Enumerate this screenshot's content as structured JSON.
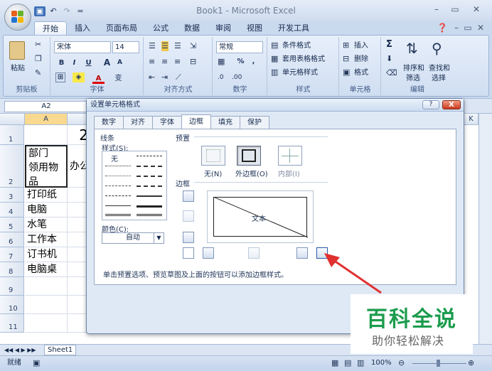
{
  "window": {
    "title": "Book1 - Microsoft Excel"
  },
  "qat": {
    "undo": "↶",
    "redo": "↷",
    "save": "▣",
    "sep": "="
  },
  "tabs": [
    "开始",
    "插入",
    "页面布局",
    "公式",
    "数据",
    "审阅",
    "视图",
    "开发工具"
  ],
  "ribbon": {
    "clipboard": {
      "paste": "粘贴",
      "label": "剪贴板"
    },
    "font": {
      "name": "宋体",
      "size": "14",
      "label": "字体",
      "bold": "B",
      "italic": "I",
      "underline": "U",
      "grow": "A",
      "shrink": "A",
      "color": "A",
      "wen": "变"
    },
    "alignment": {
      "label": "对齐方式"
    },
    "number": {
      "format": "常规",
      "percent": "%",
      "comma": ",",
      "label": "数字"
    },
    "styles": {
      "conditional": "条件格式",
      "table": "套用表格格式",
      "cell": "单元格样式",
      "label": "样式"
    },
    "cells": {
      "insert": "插入",
      "delete": "删除",
      "format": "格式",
      "label": "单元格"
    },
    "editing": {
      "sum": "Σ",
      "sort": "排序和",
      "filter": "筛选",
      "find": "查找和",
      "select": "选择",
      "label": "编辑"
    }
  },
  "formula": {
    "namebox": "A2"
  },
  "sheet": {
    "col_a": "A",
    "col_k": "K",
    "rows": [
      {
        "num": "1",
        "a": "",
        "b": "2"
      },
      {
        "num": "2",
        "a": "部门\n领用物\n品",
        "b": "办公"
      },
      {
        "num": "3",
        "a": "打印纸"
      },
      {
        "num": "4",
        "a": "电脑"
      },
      {
        "num": "5",
        "a": "水笔"
      },
      {
        "num": "6",
        "a": "工作本"
      },
      {
        "num": "7",
        "a": "订书机"
      },
      {
        "num": "8",
        "a": "电脑桌"
      },
      {
        "num": "9",
        "a": ""
      },
      {
        "num": "10",
        "a": ""
      },
      {
        "num": "11",
        "a": ""
      }
    ],
    "sheet_tab": "Sheet1"
  },
  "status": {
    "ready": "就绪",
    "zoom": "100%"
  },
  "dialog": {
    "title": "设置单元格格式",
    "help": "?",
    "close": "X",
    "tabs": [
      "数字",
      "对齐",
      "字体",
      "边框",
      "填充",
      "保护"
    ],
    "active_tab": "边框",
    "line_section": "线条",
    "style_label": "样式(S):",
    "none_style": "无",
    "color_label": "颜色(C):",
    "color_value": "自动",
    "preset_section": "预置",
    "preset_none": "无(N)",
    "preset_outline": "外边框(O)",
    "preset_inside": "内部(I)",
    "border_section": "边框",
    "preview_text": "文本",
    "hint": "单击预置选项、预览草图及上面的按钮可以添加边框样式。"
  },
  "watermark": {
    "title": "百科全说",
    "subtitle": "助你轻松解决"
  },
  "colors": {
    "arrow": "#e03131",
    "watermark_title": "#1b9c4d"
  }
}
